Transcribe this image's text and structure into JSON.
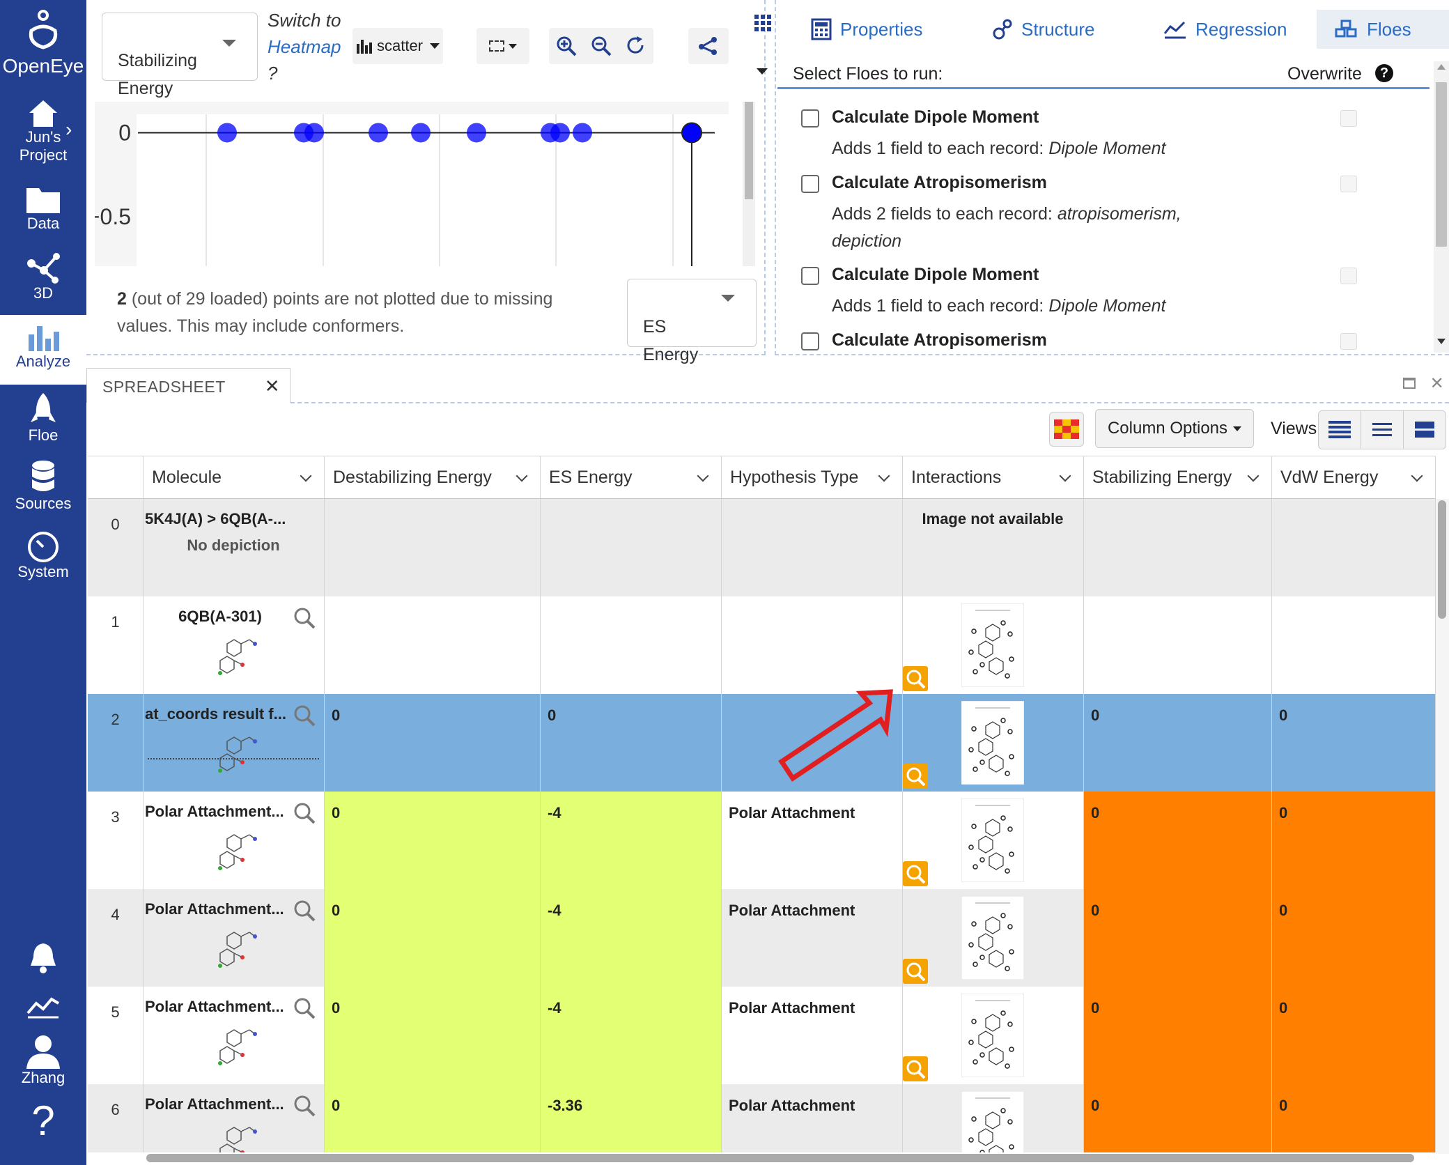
{
  "sidebar": {
    "brand": "OpenEye",
    "items": [
      {
        "label": "Jun's\nProject",
        "icon": "home-icon"
      },
      {
        "label": "Data",
        "icon": "folder-icon"
      },
      {
        "label": "3D",
        "icon": "molecule-3d-icon"
      },
      {
        "label": "Analyze",
        "icon": "bar-chart-icon"
      },
      {
        "label": "Floe",
        "icon": "rocket-icon"
      },
      {
        "label": "Sources",
        "icon": "database-icon"
      },
      {
        "label": "System",
        "icon": "gauge-icon"
      }
    ],
    "bottom": [
      {
        "label": "",
        "icon": "bell-icon"
      },
      {
        "label": "",
        "icon": "activity-icon"
      },
      {
        "label": "Zhang",
        "icon": "user-icon"
      },
      {
        "label": "",
        "icon": "help-icon"
      }
    ]
  },
  "chart_panel": {
    "y_field": "Stabilizing\nEnergy",
    "switch_prefix": "Switch to",
    "switch_link": "Heatmap",
    "switch_suffix": "?",
    "plot_type": "scatter",
    "x_field": "ES\nEnergy",
    "missing_count": "2",
    "missing_text": "(out of 29 loaded) points are not plotted due to missing values. This may include conformers."
  },
  "chart_data": {
    "type": "scatter",
    "title": "",
    "xlabel": "",
    "ylabel": "",
    "y_ticks": [
      "0",
      "−0.5"
    ],
    "ylim": [
      -0.8,
      0.1
    ],
    "points_y": [
      0,
      0,
      0,
      0,
      0,
      0,
      0,
      0,
      0,
      0
    ],
    "grid": true
  },
  "floe_panel": {
    "tabs": [
      {
        "label": "Properties",
        "icon": "calculator-icon"
      },
      {
        "label": "Structure",
        "icon": "structure-icon"
      },
      {
        "label": "Regression",
        "icon": "trend-icon"
      },
      {
        "label": "Floes",
        "icon": "cubes-icon"
      }
    ],
    "select_label": "Select Floes to run:",
    "overwrite_label": "Overwrite",
    "floes": [
      {
        "title": "Calculate Dipole Moment",
        "desc_prefix": "Adds 1 field to each record:",
        "desc_fields": "Dipole Moment"
      },
      {
        "title": "Calculate Atropisomerism",
        "desc_prefix": "Adds 2 fields to each record:",
        "desc_fields": "atropisomerism, depiction"
      },
      {
        "title": "Calculate Dipole Moment",
        "desc_prefix": "Adds 1 field to each record:",
        "desc_fields": "Dipole Moment"
      },
      {
        "title": "Calculate Atropisomerism",
        "desc_prefix": "",
        "desc_fields": ""
      }
    ]
  },
  "spreadsheet": {
    "tab_label": "SPREADSHEET",
    "column_options": "Column Options",
    "views_label": "Views:",
    "columns": [
      "Molecule",
      "Destabilizing Energy",
      "ES Energy",
      "Hypothesis Type",
      "Interactions",
      "Stabilizing Energy",
      "VdW Energy"
    ],
    "rows": [
      {
        "idx": "0",
        "molecule": "5K4J(A) > 6QB(A-...",
        "mol_sub": "No depiction",
        "destab": "",
        "es": "",
        "hyp": "",
        "interactions": "Image not available",
        "stab": "",
        "vdw": "",
        "bg": "#ebebeb"
      },
      {
        "idx": "1",
        "molecule": "6QB(A-301)",
        "mol_sub": "",
        "destab": "",
        "es": "",
        "hyp": "",
        "interactions": "",
        "stab": "",
        "vdw": "",
        "bg": "#ffffff"
      },
      {
        "idx": "2",
        "molecule": "at_coords result f...",
        "mol_sub": "",
        "destab": "0",
        "es": "0",
        "hyp": "",
        "interactions": "",
        "stab": "0",
        "vdw": "0",
        "bg": "#7aaedc"
      },
      {
        "idx": "3",
        "molecule": "Polar Attachment...",
        "mol_sub": "",
        "destab": "0",
        "es": "-4",
        "hyp": "Polar Attachment",
        "interactions": "",
        "stab": "0",
        "vdw": "0",
        "bg": "#ffffff"
      },
      {
        "idx": "4",
        "molecule": "Polar Attachment...",
        "mol_sub": "",
        "destab": "0",
        "es": "-4",
        "hyp": "Polar Attachment",
        "interactions": "",
        "stab": "0",
        "vdw": "0",
        "bg": "#ebebeb"
      },
      {
        "idx": "5",
        "molecule": "Polar Attachment...",
        "mol_sub": "",
        "destab": "0",
        "es": "-4",
        "hyp": "Polar Attachment",
        "interactions": "",
        "stab": "0",
        "vdw": "0",
        "bg": "#ffffff"
      },
      {
        "idx": "6",
        "molecule": "Polar Attachment...",
        "mol_sub": "",
        "destab": "0",
        "es": "-3.36",
        "hyp": "Polar Attachment",
        "interactions": "",
        "stab": "0",
        "vdw": "0",
        "bg": "#ebebeb"
      }
    ],
    "colors": {
      "lime": "#e3ff73",
      "orange": "#ff8000",
      "selected": "#7aaedc",
      "badge": "#f4a300",
      "accent": "#2a6cc4",
      "sidebar": "#233f8f"
    }
  }
}
